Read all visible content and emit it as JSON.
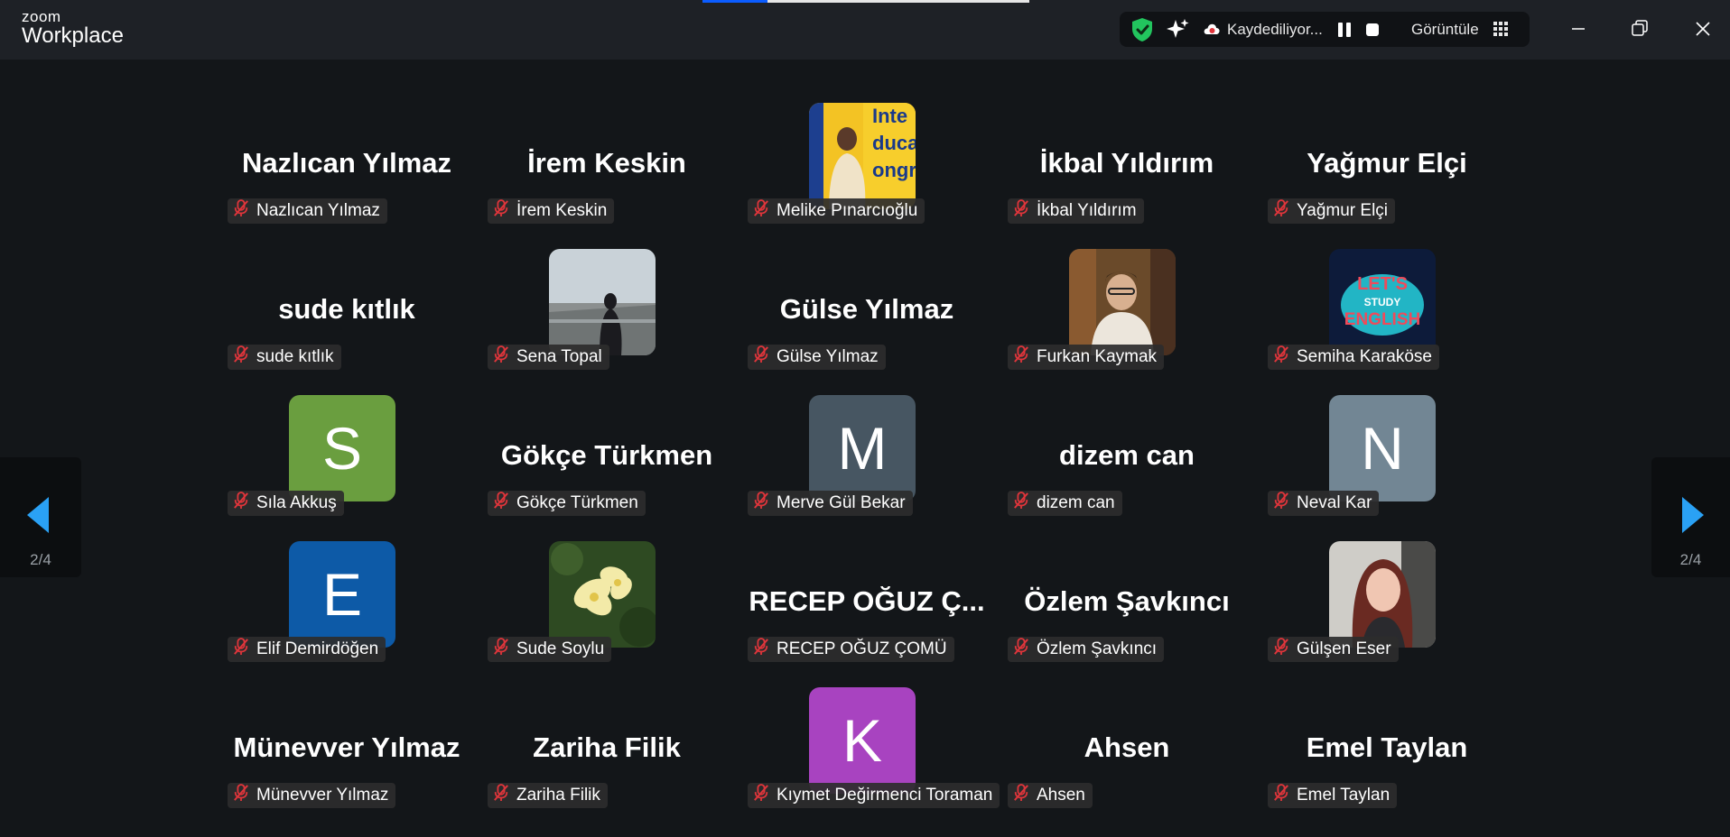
{
  "app": {
    "brand_top": "zoom",
    "brand_bottom": "Workplace"
  },
  "toolbar": {
    "recording_text": "Kaydediliyor...",
    "view_label": "Görüntüle"
  },
  "pager": {
    "left_page": "2/4",
    "right_page": "2/4"
  },
  "participants": [
    {
      "label": "Nazlıcan Yılmaz",
      "display": "Nazlıcan Yılmaz",
      "kind": "name"
    },
    {
      "label": "İrem Keskin",
      "display": "İrem Keskin",
      "kind": "name"
    },
    {
      "label": "Melike Pınarcıoğlu",
      "kind": "photo",
      "photo": "photo-melike"
    },
    {
      "label": "İkbal Yıldırım",
      "display": "İkbal Yıldırım",
      "kind": "name"
    },
    {
      "label": "Yağmur Elçi",
      "display": "Yağmur Elçi",
      "kind": "name"
    },
    {
      "label": "sude kıtlık",
      "display": "sude kıtlık",
      "kind": "name"
    },
    {
      "label": "Sena Topal",
      "kind": "photo",
      "photo": "photo-sena"
    },
    {
      "label": "Gülse Yılmaz",
      "display": "Gülse Yılmaz",
      "kind": "name"
    },
    {
      "label": "Furkan Kaymak",
      "kind": "photo",
      "photo": "photo-furkan"
    },
    {
      "label": "Semiha Karaköse",
      "kind": "photo",
      "photo": "photo-semiha"
    },
    {
      "label": "Sıla Akkuş",
      "kind": "initial",
      "initial": "S",
      "color": "#6a9e3f"
    },
    {
      "label": "Gökçe Türkmen",
      "display": "Gökçe Türkmen",
      "kind": "name"
    },
    {
      "label": "Merve Gül Bekar",
      "kind": "initial",
      "initial": "M",
      "color": "#475662"
    },
    {
      "label": "dizem can",
      "display": "dizem can",
      "kind": "name"
    },
    {
      "label": "Neval Kar",
      "kind": "initial",
      "initial": "N",
      "color": "#728694"
    },
    {
      "label": "Elif Demirdöğen",
      "kind": "initial",
      "initial": "E",
      "color": "#0d5aa7"
    },
    {
      "label": "Sude Soylu",
      "kind": "photo",
      "photo": "photo-flower"
    },
    {
      "label": "RECEP OĞUZ ÇOMÜ",
      "display": "RECEP OĞUZ Ç...",
      "kind": "name"
    },
    {
      "label": "Özlem Şavkıncı",
      "display": "Özlem Şavkıncı",
      "kind": "name"
    },
    {
      "label": "Gülşen Eser",
      "kind": "photo",
      "photo": "photo-gulsen"
    },
    {
      "label": "Münevver Yılmaz",
      "display": "Münevver Yılmaz",
      "kind": "name"
    },
    {
      "label": "Zariha Filik",
      "display": "Zariha Filik",
      "kind": "name"
    },
    {
      "label": "Kıymet Değirmenci Toraman",
      "kind": "initial",
      "initial": "K",
      "color": "#a843c0"
    },
    {
      "label": "Ahsen",
      "display": "Ahsen",
      "kind": "name"
    },
    {
      "label": "Emel Taylan",
      "display": "Emel Taylan",
      "kind": "name"
    }
  ],
  "colors": {
    "background": "#131619",
    "titlebar": "#1e2126",
    "accent_blue": "#2aa1f5",
    "muted_red": "#e0353b",
    "shield_green": "#22c55e"
  }
}
